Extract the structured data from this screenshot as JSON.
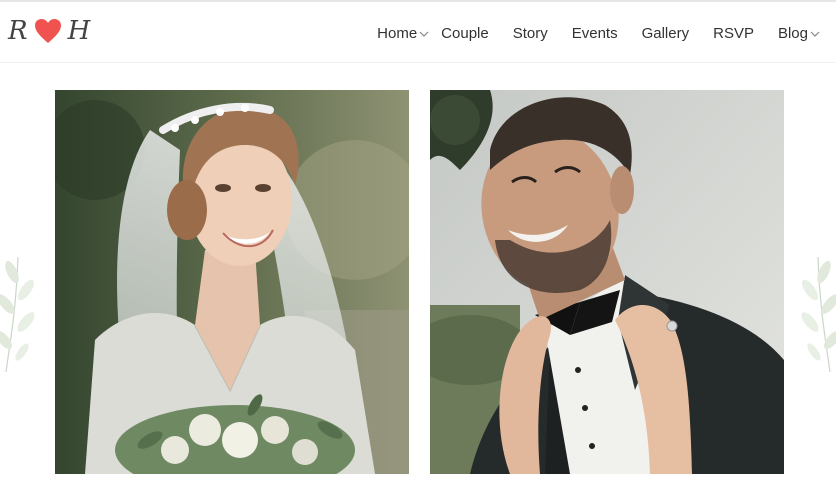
{
  "logo": {
    "left_initial": "R",
    "right_initial": "H",
    "heart_icon": "heart-icon",
    "heart_color": "#f0534f"
  },
  "nav": {
    "items": [
      {
        "label": "Home",
        "has_dropdown": true
      },
      {
        "label": "Couple",
        "has_dropdown": false
      },
      {
        "label": "Story",
        "has_dropdown": false
      },
      {
        "label": "Events",
        "has_dropdown": false
      },
      {
        "label": "Gallery",
        "has_dropdown": false
      },
      {
        "label": "RSVP",
        "has_dropdown": false
      },
      {
        "label": "Blog",
        "has_dropdown": true
      }
    ],
    "dropdown_icon": "chevron-down-icon"
  },
  "photos": {
    "bride": {
      "subject": "bride-portrait"
    },
    "groom": {
      "subject": "groom-portrait"
    }
  },
  "colors": {
    "accent": "#f0534f",
    "text": "#333333",
    "background": "#ffffff"
  }
}
